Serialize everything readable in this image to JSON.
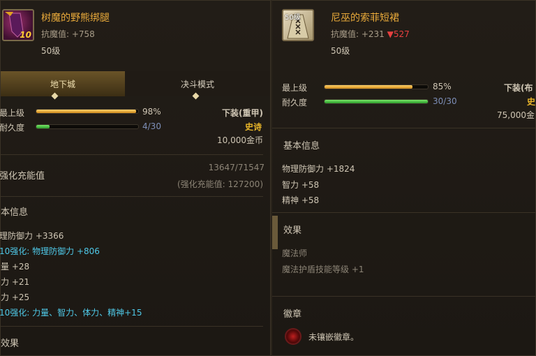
{
  "left": {
    "name": "树魔的野熊绑腿",
    "resist": "抗魔值: +758",
    "level": "50级",
    "icon_number": "10",
    "tabs": [
      "地下城",
      "决斗模式"
    ],
    "max_label": "最上级",
    "max_pct": "98%",
    "max_value": 0.98,
    "dur_label": "耐久度",
    "dur_text": "4/30",
    "dur_value": 0.133,
    "equip_type": "下装(重甲)",
    "rarity": "史诗",
    "price": "10,000金币",
    "enhance_label": "强化充能值",
    "enhance_value": "13647/71547",
    "enhance_sub": "(强化充能值: 127200)",
    "basic_info_label": "本信息",
    "stats": [
      {
        "text": "理防御力 +3366",
        "style": "txt"
      },
      {
        "text": "10强化: 物理防御力 +806",
        "style": "cyan"
      },
      {
        "text": "量 +28",
        "style": "txt"
      },
      {
        "text": "力 +21",
        "style": "txt"
      },
      {
        "text": "力 +25",
        "style": "txt"
      },
      {
        "text": "10强化: 力量、智力、体力、精神+15",
        "style": "cyan"
      }
    ],
    "effect_label": "效果"
  },
  "right": {
    "name": "尼巫的索菲短裙",
    "resist": "抗魔值: +231",
    "resist_diff": "▼527",
    "level": "50级",
    "icon_label": "50级",
    "max_label": "最上级",
    "max_pct": "85%",
    "max_value": 0.85,
    "dur_label": "耐久度",
    "dur_text": "30/30",
    "dur_value": 1.0,
    "equip_type": "下装(布",
    "rarity": "史",
    "price": "75,000金",
    "basic_info_label": "基本信息",
    "stats": [
      "物理防御力 +1824",
      "智力 +58",
      "精神 +58"
    ],
    "effect_label": "效果",
    "effects": [
      "魔法师",
      "魔法护盾技能等级 +1"
    ],
    "emblem_label": "徽章",
    "emblem_text": "未镶嵌徽章。"
  },
  "colors": {
    "title": "#e8a93a",
    "cyan": "#4fc9e8",
    "gold": "#e8b52a",
    "down": "#e84040"
  }
}
